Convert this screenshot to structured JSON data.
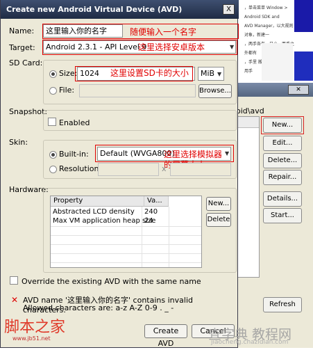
{
  "background_site": {
    "text_lines": [
      "，单击菜单 Window > Android SDK and",
      "AVD Manager，以大规则对象，新建一",
      "",
      "",
      "",
      "，两手各有一只小，两手之外都有",
      "",
      "",
      "，手里 搬到了很多，打算用手",
      "A.V.D",
      "（如下 图）"
    ]
  },
  "avd_manager": {
    "close_label": "Close",
    "path_text": "oid\\avd",
    "buttons": [
      "New...",
      "Edit...",
      "Delete...",
      "Repair...",
      "Details...",
      "Start...",
      "Refresh"
    ]
  },
  "dialog": {
    "title": "Create new Android Virtual Device (AVD)",
    "close_label": "X",
    "name_label": "Name:",
    "name_value": "这里输入你的名字",
    "target_label": "Target:",
    "target_value": "Android 2.3.1 - API Level 9",
    "sdcard_label": "SD Card:",
    "size_label": "Size:",
    "size_value": "1024",
    "size_unit": "MiB",
    "file_label": "File:",
    "browse_label": "Browse...",
    "snapshot_label": "Snapshot:",
    "enabled_label": "Enabled",
    "skin_label": "Skin:",
    "builtin_label": "Built-in:",
    "builtin_value": "Default (WVGA800)",
    "resolution_label": "Resolution:",
    "resolution_x": "x",
    "hardware_label": "Hardware:",
    "hw_columns": [
      "Property",
      "Va..."
    ],
    "hw_rows": [
      {
        "property": "Abstracted LCD density",
        "value": "240"
      },
      {
        "property": "Max VM application heap size",
        "value": "24"
      }
    ],
    "hw_new_label": "New...",
    "hw_delete_label": "Delete",
    "override_label": "Override the existing AVD with the same name",
    "error_icon": "✕",
    "error_line1": "AVD name '这里输入你的名字' contains invalid characters.",
    "error_line2": "Allowed characters are: a-z A-Z 0-9 . _ -",
    "create_label": "Create AVD",
    "cancel_label": "Cancel"
  },
  "annotations": {
    "name_note": "随便输入一个名字",
    "target_note": "这里选择安卓版本",
    "size_note": "这里设置SD卡的大小",
    "skin_note_1": "这里选择模拟器",
    "skin_note_2": "的屏幕大小"
  },
  "watermarks": {
    "logo_text": "脚本之家",
    "logo_url": "www.jb51.net",
    "site_text": "查字典 教程网",
    "site_url": "jiaocheng.chazidian.com"
  },
  "colors": {
    "annotation_red": "#e00000",
    "title_bar": "#1f2b44",
    "dialog_bg": "#ece9d8"
  }
}
